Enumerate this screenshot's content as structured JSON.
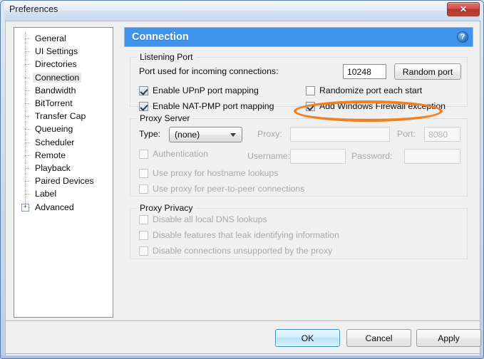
{
  "window": {
    "title": "Preferences",
    "close_label": "✕"
  },
  "sidebar": {
    "items": [
      {
        "label": "General",
        "selected": false,
        "expandable": false
      },
      {
        "label": "UI Settings",
        "selected": false,
        "expandable": false
      },
      {
        "label": "Directories",
        "selected": false,
        "expandable": false
      },
      {
        "label": "Connection",
        "selected": true,
        "expandable": false
      },
      {
        "label": "Bandwidth",
        "selected": false,
        "expandable": false
      },
      {
        "label": "BitTorrent",
        "selected": false,
        "expandable": false
      },
      {
        "label": "Transfer Cap",
        "selected": false,
        "expandable": false
      },
      {
        "label": "Queueing",
        "selected": false,
        "expandable": false
      },
      {
        "label": "Scheduler",
        "selected": false,
        "expandable": false
      },
      {
        "label": "Remote",
        "selected": false,
        "expandable": false
      },
      {
        "label": "Playback",
        "selected": false,
        "expandable": false
      },
      {
        "label": "Paired Devices",
        "selected": false,
        "expandable": false
      },
      {
        "label": "Label",
        "selected": false,
        "expandable": false
      },
      {
        "label": "Advanced",
        "selected": false,
        "expandable": true,
        "expander_glyph": "+"
      }
    ]
  },
  "pane": {
    "header_title": "Connection",
    "help_glyph": "?",
    "listening_port": {
      "legend": "Listening Port",
      "port_label": "Port used for incoming connections:",
      "port_value": "10248",
      "random_port_button": "Random port",
      "upnp_label": "Enable UPnP port mapping",
      "upnp_checked": true,
      "natpmp_label": "Enable NAT-PMP port mapping",
      "natpmp_checked": true,
      "randomize_label": "Randomize port each start",
      "randomize_checked": false,
      "firewall_label": "Add Windows Firewall exception",
      "firewall_checked": true
    },
    "proxy_server": {
      "legend": "Proxy Server",
      "type_label": "Type:",
      "type_value": "(none)",
      "proxy_label": "Proxy:",
      "proxy_value": "",
      "port_label": "Port:",
      "port_value": "8080",
      "auth_label": "Authentication",
      "auth_checked": false,
      "username_label": "Username:",
      "username_value": "",
      "password_label": "Password:",
      "password_value": "",
      "hostname_label": "Use proxy for hostname lookups",
      "hostname_checked": false,
      "p2p_label": "Use proxy for peer-to-peer connections",
      "p2p_checked": false
    },
    "proxy_privacy": {
      "legend": "Proxy Privacy",
      "dns_label": "Disable all local DNS lookups",
      "dns_checked": false,
      "leak_label": "Disable features that leak identifying information",
      "leak_checked": false,
      "unsupported_label": "Disable connections unsupported by the proxy",
      "unsupported_checked": false
    }
  },
  "footer": {
    "ok_label": "OK",
    "cancel_label": "Cancel",
    "apply_label": "Apply"
  },
  "annotation": {
    "shape": "ellipse",
    "color": "#f08020",
    "targets": "Add Windows Firewall exception"
  },
  "colors": {
    "header_blue": "#3f93ed",
    "annotation_orange": "#f08020",
    "close_red": "#b4332c",
    "dialog_gray": "#f0f0f0"
  }
}
